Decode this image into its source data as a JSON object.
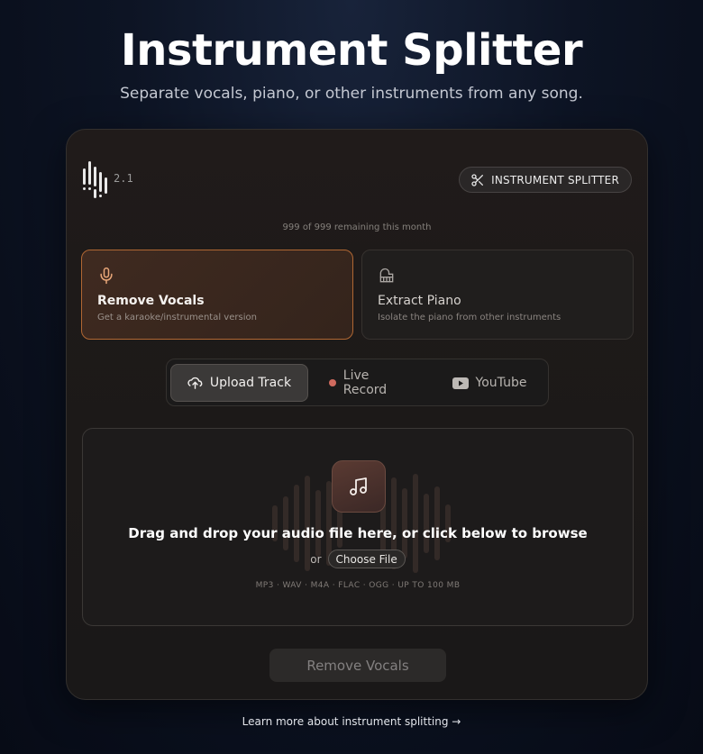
{
  "header": {
    "title": "Instrument Splitter",
    "subtitle": "Separate vocals, piano, or other instruments from any song."
  },
  "card": {
    "version": "2.1",
    "mode_label": "INSTRUMENT SPLITTER",
    "remaining": "999 of 999 remaining this month",
    "options": [
      {
        "title": "Remove Vocals",
        "description": "Get a karaoke/instrumental version",
        "icon": "microphone-icon",
        "selected": true
      },
      {
        "title": "Extract Piano",
        "description": "Isolate the piano from other instruments",
        "icon": "piano-icon",
        "selected": false
      }
    ],
    "tabs": [
      {
        "label": "Upload Track",
        "icon": "cloud-upload-icon",
        "active": true
      },
      {
        "label": "Live Record",
        "icon": "record-dot-icon",
        "active": false
      },
      {
        "label": "YouTube",
        "icon": "youtube-icon",
        "active": false
      }
    ],
    "dropzone": {
      "prompt": "Drag and drop your audio file here, or click below to browse",
      "or_text": "or",
      "choose_label": "Choose File",
      "formats": "MP3 · WAV · M4A · FLAC · OGG · UP TO 100 MB"
    },
    "submit_label": "Remove Vocals"
  },
  "footer": {
    "learn_more": "Learn more about instrument splitting →"
  },
  "colors": {
    "accent": "#b06733",
    "record_dot": "#d06a5e",
    "background": "#0d1424"
  }
}
